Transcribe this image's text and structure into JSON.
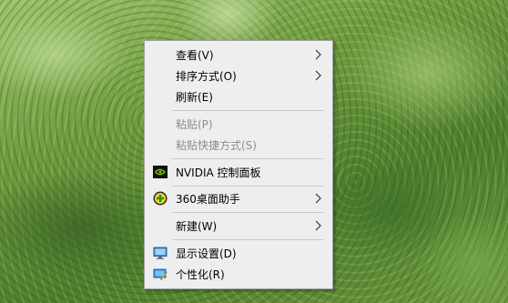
{
  "context_menu": {
    "items": [
      {
        "label": "查看(V)"
      },
      {
        "label": "排序方式(O)"
      },
      {
        "label": "刷新(E)"
      },
      {
        "label": "粘贴(P)"
      },
      {
        "label": "粘贴快捷方式(S)"
      },
      {
        "label": "NVIDIA 控制面板",
        "icon": "nvidia-icon"
      },
      {
        "label": "360桌面助手",
        "icon": "360-desktop-assistant-icon"
      },
      {
        "label": "新建(W)"
      },
      {
        "label": "显示设置(D)",
        "icon": "display-icon"
      },
      {
        "label": "个性化(R)",
        "icon": "personalize-icon"
      }
    ]
  },
  "colors": {
    "menu_background": "#eeeeee",
    "disabled_text": "#8c8c8c",
    "separator": "#c8c8c8"
  }
}
